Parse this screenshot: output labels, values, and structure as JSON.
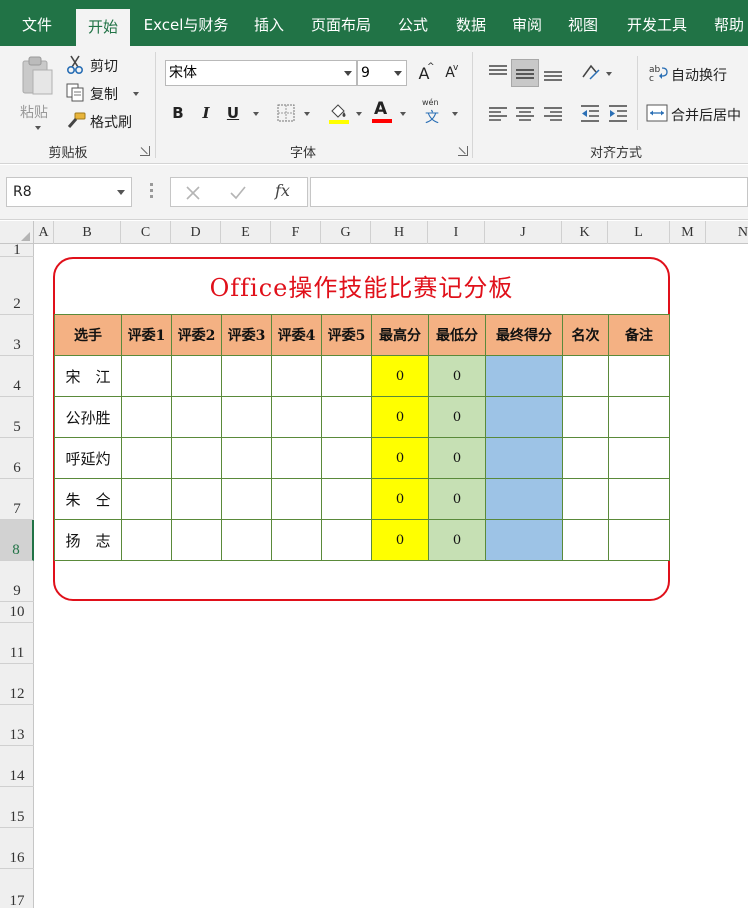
{
  "tabs": [
    {
      "label": "文件",
      "active": false
    },
    {
      "label": "开始",
      "active": true
    },
    {
      "label": "Excel与财务",
      "active": false
    },
    {
      "label": "插入",
      "active": false
    },
    {
      "label": "页面布局",
      "active": false
    },
    {
      "label": "公式",
      "active": false
    },
    {
      "label": "数据",
      "active": false
    },
    {
      "label": "审阅",
      "active": false
    },
    {
      "label": "视图",
      "active": false
    },
    {
      "label": "开发工具",
      "active": false
    },
    {
      "label": "帮助",
      "active": false
    }
  ],
  "ribbon": {
    "clipboard": {
      "paste_label": "粘贴",
      "cut_label": "剪切",
      "copy_label": "复制",
      "format_painter_label": "格式刷",
      "group_title": "剪贴板"
    },
    "font": {
      "font_name": "宋体",
      "font_size": "9",
      "bold": "B",
      "italic": "I",
      "underline": "U",
      "increase_size": "A",
      "decrease_size": "A",
      "font_color_glyph": "A",
      "phonetic_glyph": "wén",
      "phonetic_char": "文",
      "group_title": "字体",
      "fill_color": "#ffff00",
      "font_color": "#ff0000"
    },
    "alignment": {
      "wrap_text_label": "自动换行",
      "merge_center_label": "合并后居中",
      "group_title": "对齐方式"
    }
  },
  "formula_bar": {
    "name_box": "R8",
    "fx_label": "fx",
    "formula": ""
  },
  "grid": {
    "columns": [
      "A",
      "B",
      "C",
      "D",
      "E",
      "F",
      "G",
      "H",
      "I",
      "J",
      "K",
      "L",
      "M",
      "N"
    ],
    "rows": [
      "1",
      "2",
      "3",
      "4",
      "5",
      "6",
      "7",
      "8",
      "9",
      "10",
      "11",
      "12",
      "13",
      "14",
      "15",
      "16",
      "17"
    ],
    "selected_row": "8"
  },
  "board": {
    "title": "Office操作技能比赛记分板",
    "headers": [
      "选手",
      "评委1",
      "评委2",
      "评委3",
      "评委4",
      "评委5",
      "最高分",
      "最低分",
      "最终得分",
      "名次",
      "备注"
    ],
    "rows": [
      {
        "name": "宋　江",
        "max": "0",
        "min": "0"
      },
      {
        "name": "公孙胜",
        "max": "0",
        "min": "0"
      },
      {
        "name": "呼延灼",
        "max": "0",
        "min": "0"
      },
      {
        "name": "朱　仝",
        "max": "0",
        "min": "0"
      },
      {
        "name": "扬　志",
        "max": "0",
        "min": "0"
      }
    ]
  },
  "colors": {
    "app_green": "#217346",
    "board_red": "#e0101a",
    "header_orange": "#f4b183",
    "max_yellow": "#ffff00",
    "min_green": "#c6e0b4",
    "final_blue": "#9dc3e6"
  }
}
